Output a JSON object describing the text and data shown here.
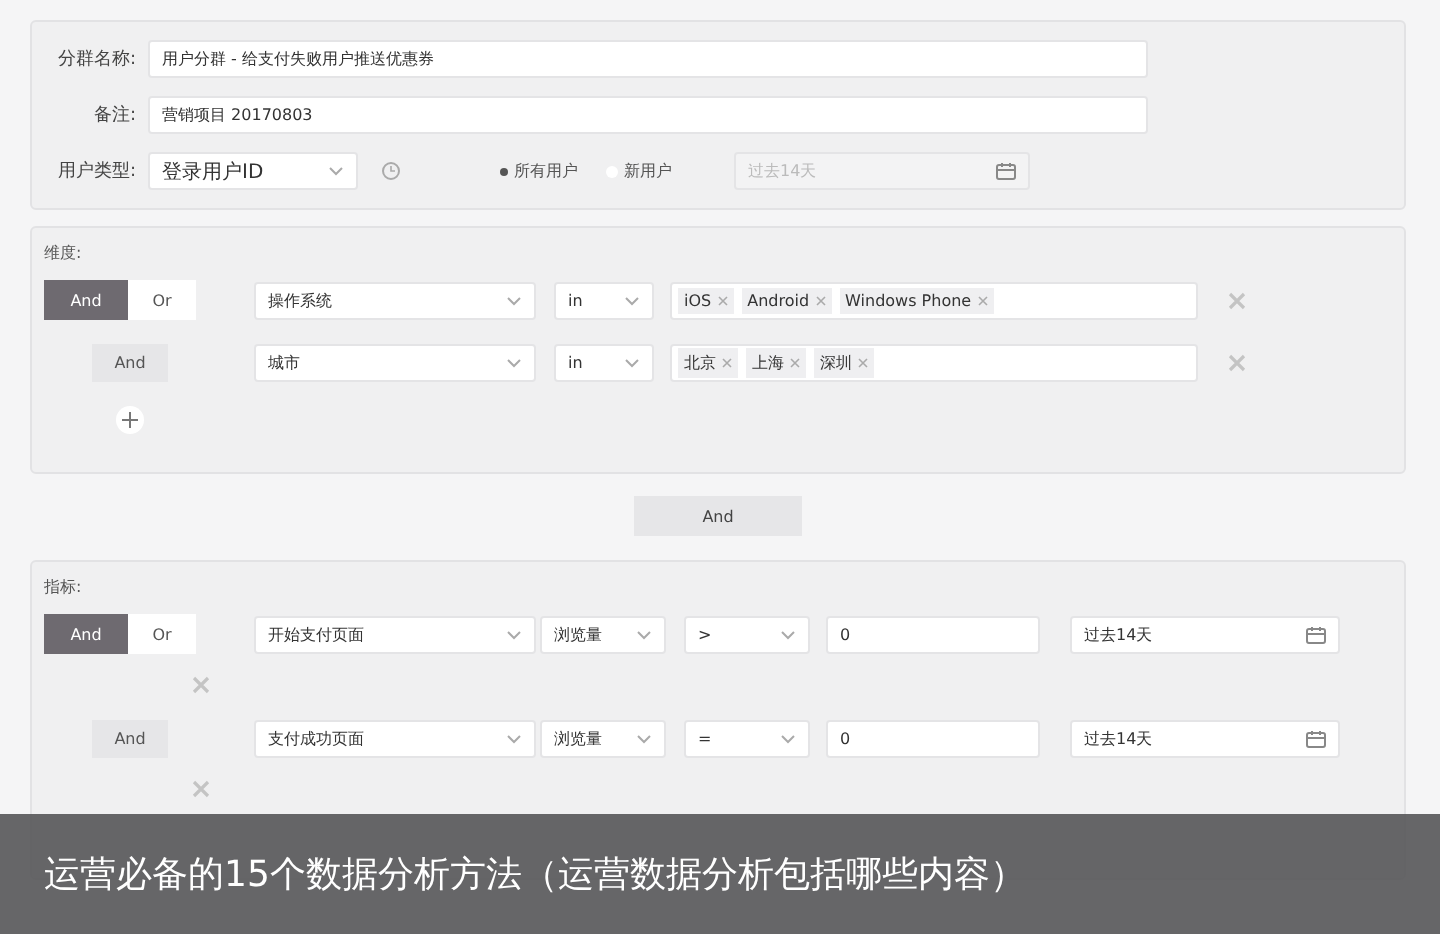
{
  "form": {
    "fields": [
      {
        "label": "分群名称:",
        "value": "用户分群 - 给支付失败用户推送优惠券"
      },
      {
        "label": "备注:",
        "value": "营销项目 20170803"
      }
    ],
    "user_type": {
      "label": "用户类型:",
      "select": "登录用户ID",
      "options": [
        {
          "label": "所有用户",
          "selected": true
        },
        {
          "label": "新用户",
          "selected": false
        }
      ],
      "date_range": {
        "value": "过去14天",
        "disabled": true
      }
    }
  },
  "dimensions": {
    "title": "维度:",
    "logic": [
      {
        "label": "And",
        "selected": true
      },
      {
        "label": "Or",
        "selected": false
      }
    ],
    "rows": [
      {
        "field": "操作系统",
        "operator": "in",
        "tags": [
          "iOS",
          "Android",
          "Windows Phone"
        ]
      },
      {
        "connector": "And",
        "field": "城市",
        "operator": "in",
        "tags": [
          "北京",
          "上海",
          "深圳"
        ]
      }
    ]
  },
  "join": "And",
  "metrics": {
    "title": "指标:",
    "logic": [
      {
        "label": "And",
        "selected": true
      },
      {
        "label": "Or",
        "selected": false
      }
    ],
    "rows": [
      {
        "event": "开始支付页面",
        "measure": "浏览量",
        "comparator": ">",
        "value": "0",
        "date": "过去14天"
      },
      {
        "connector": "And",
        "event": "支付成功页面",
        "measure": "浏览量",
        "comparator": "=",
        "value": "0",
        "date": "过去14天"
      }
    ]
  },
  "caption": "运营必备的15个数据分析方法（运营数据分析包括哪些内容）"
}
